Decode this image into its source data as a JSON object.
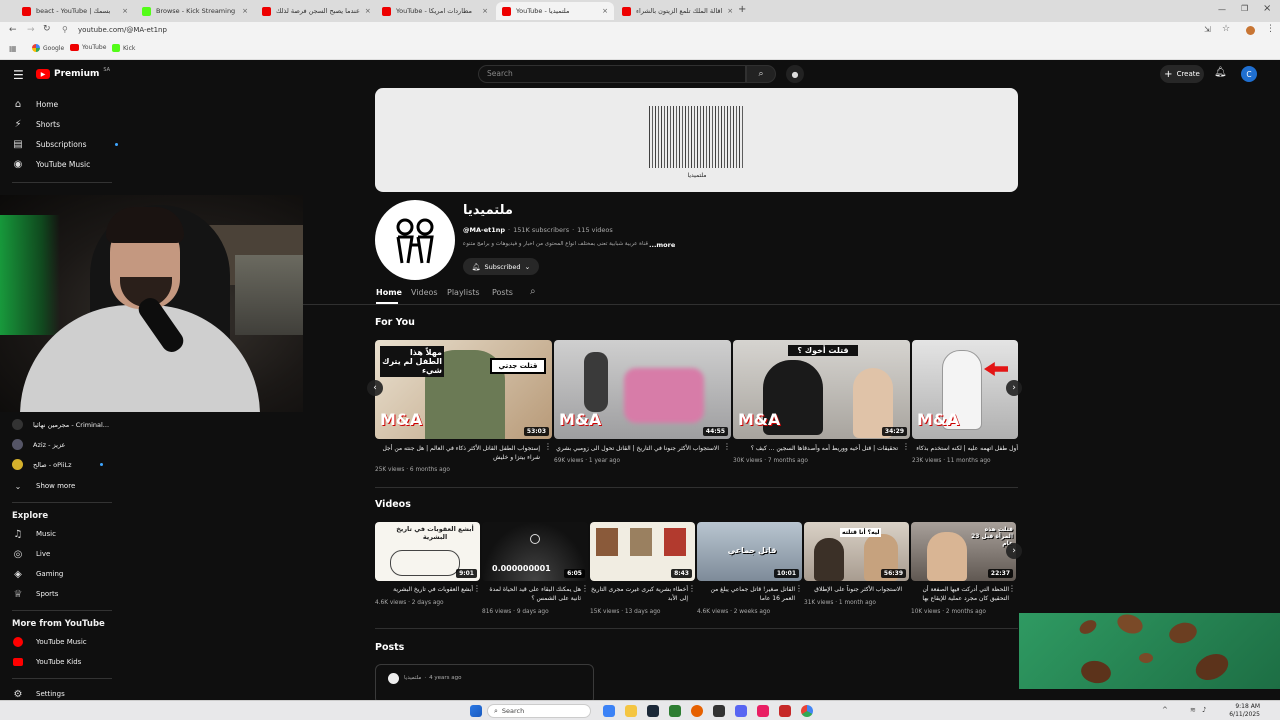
{
  "browser": {
    "tabs": [
      {
        "label": "beact - YouTube | بسمك",
        "active": false
      },
      {
        "label": "Browse - Kick Streaming",
        "active": false
      },
      {
        "label": "عندما يصبح السجن فرصة لذلك",
        "active": false
      },
      {
        "label": "YouTube - مطاردات امريكا",
        "active": false
      },
      {
        "label": "YouTube - ملتميديا",
        "active": true
      },
      {
        "label": "اقالة الملك تلمع الزيتون بالشراء",
        "active": false
      }
    ],
    "new_tab": "+",
    "url": "youtube.com/@MA-et1np",
    "bookmarks": [
      "Google",
      "YouTube",
      "Kick"
    ]
  },
  "youtube": {
    "logo": "Premium",
    "logo_region": "SA",
    "search_placeholder": "Search",
    "create_label": "Create",
    "avatar_letter": "C",
    "sidebar": {
      "main": [
        {
          "label": "Home",
          "icon": "home-icon",
          "glyph": "⌂"
        },
        {
          "label": "Shorts",
          "icon": "shorts-icon",
          "glyph": "⚡"
        },
        {
          "label": "Subscriptions",
          "icon": "subscriptions-icon",
          "glyph": "▤"
        },
        {
          "label": "YouTube Music",
          "icon": "music-icon",
          "glyph": "◉"
        }
      ],
      "subscriptions": [
        {
          "label": "مجرمين نهائيا - Criminal..."
        },
        {
          "label": "Aziz - عزيز"
        },
        {
          "label": "صالح - oPiiLz"
        }
      ],
      "show_more": "Show more",
      "explore_title": "Explore",
      "explore": [
        {
          "label": "Music",
          "glyph": "♫"
        },
        {
          "label": "Live",
          "glyph": "◎"
        },
        {
          "label": "Gaming",
          "glyph": "◈"
        },
        {
          "label": "Sports",
          "glyph": "♕"
        }
      ],
      "more_title": "More from YouTube",
      "more": [
        {
          "label": "YouTube Music"
        },
        {
          "label": "YouTube Kids"
        }
      ],
      "settings": "Settings"
    },
    "channel": {
      "name": "ملتميديا",
      "handle": "@MA-et1np",
      "subs": "151K subscribers",
      "videos": "115 videos",
      "description": "قناة عربية شبابية تعنى بمختلف أنواع المحتوى من أخبار و فيديوهات و برامج متنوعة",
      "more": "...more",
      "subscribed_label": "Subscribed",
      "banner_text": "ملتميديا",
      "tabs": [
        "Home",
        "Videos",
        "Playlists",
        "Posts"
      ]
    },
    "for_you": {
      "title": "For You",
      "items": [
        {
          "title": "إستجواب الطفل القاتل الأكثر ذكاء في العالم | هل جنته من أجل شراء بيتزا و خليش",
          "views": "25K views",
          "age": "6 months ago",
          "duration": "53:03",
          "overlay": "قتلت جدتي"
        },
        {
          "title": "الاستجواب الأكثر جنونا في التاريخ | القاتل تحول الى زومبي بشري",
          "views": "69K views",
          "age": "1 year ago",
          "duration": "44:55",
          "overlay": ""
        },
        {
          "title": "تحقيقات | قتل أخيه ووريط أمه وأصدقاها السجين ... كيف ؟",
          "views": "30K views",
          "age": "7 months ago",
          "duration": "34:29",
          "overlay": "قتلت أخوك ؟"
        },
        {
          "title": "أول طفل اتهمه عليه | لكنه استخدم بذكاء المحبس",
          "views": "23K views",
          "age": "11 months ago",
          "duration": "",
          "overlay": ""
        }
      ]
    },
    "videos": {
      "title": "Videos",
      "items": [
        {
          "title": "أبشع العقوبات في تاريخ البشرية",
          "views": "4.6K views",
          "age": "2 days ago",
          "duration": "9:01",
          "overlay": "أبشع العقوبات في تاريخ البشرية"
        },
        {
          "title": "هل يمكنك البقاء على قيد الحياة لمدة ثانية على الشمس ؟",
          "views": "816 views",
          "age": "9 days ago",
          "duration": "6:05",
          "overlay": "0.000000001"
        },
        {
          "title": "أخطاء بشرية كبرى غيرت مجرى التاريخ إلى الأبد",
          "views": "15K views",
          "age": "13 days ago",
          "duration": "8:43",
          "overlay": ""
        },
        {
          "title": "القاتل صغير! قاتل جماعي يبلغ من العمر 16 عاما",
          "views": "4.6K views",
          "age": "2 weeks ago",
          "duration": "10:01",
          "overlay": "قاتل جماعي"
        },
        {
          "title": "الاستجواب الأكثر جنوناً على الإطلاق",
          "views": "31K views",
          "age": "1 month ago",
          "duration": "56:39",
          "overlay": "ليه؟ أنا قتلته"
        },
        {
          "title": "اللحظة التي أدركت فيها الصفعة أن التحقيق كان مجرد عملية للإيقاع بها",
          "views": "10K views",
          "age": "2 months ago",
          "duration": "22:37",
          "overlay": "قتلت هذه المرأة قبل 23 عام"
        }
      ]
    },
    "posts": {
      "title": "Posts",
      "author": "ملتميديا",
      "age": "4 years ago"
    }
  },
  "taskbar": {
    "search": "Search",
    "time": "9:18 AM",
    "date": "6/11/2025"
  },
  "colors": {
    "yt_red": "#ff0000",
    "bg": "#0f0f0f",
    "overlay_green": "#2e8a5a"
  }
}
